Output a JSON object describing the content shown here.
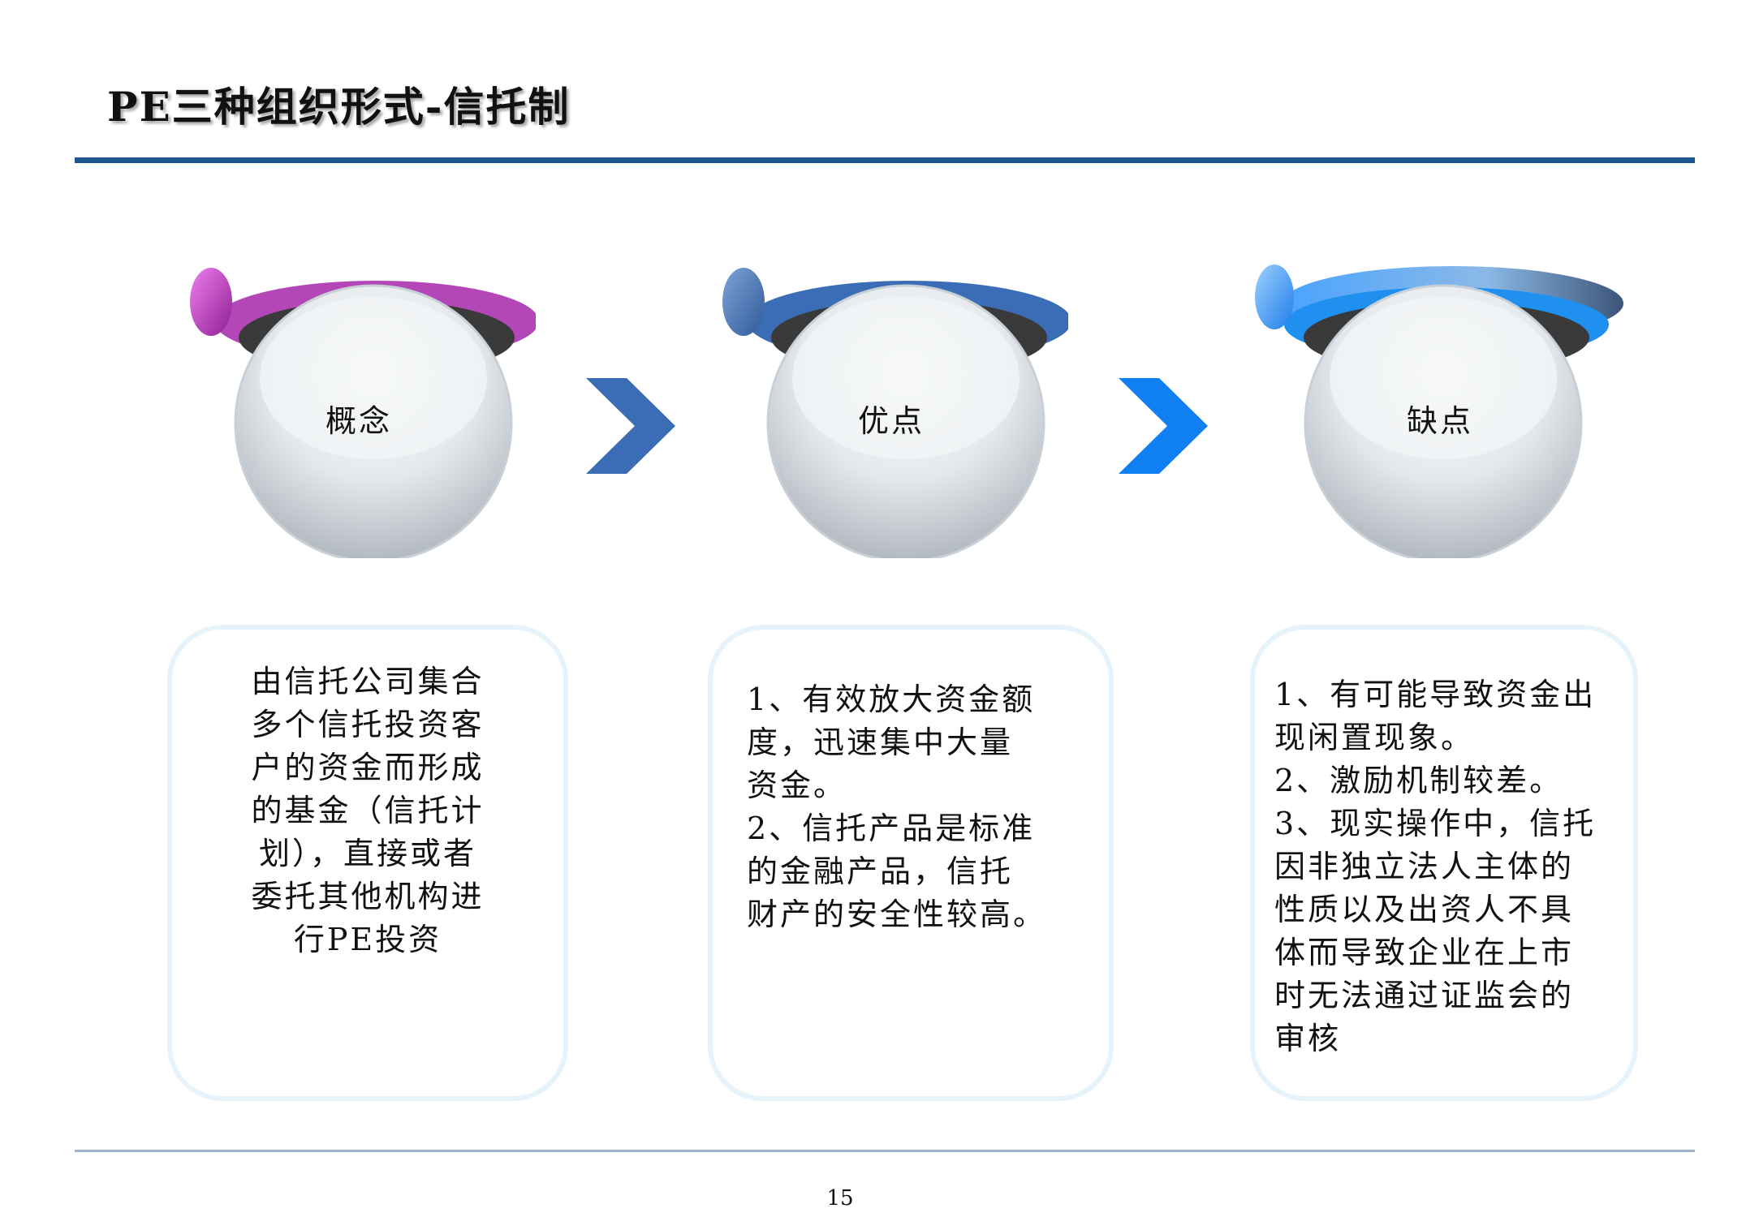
{
  "slide": {
    "title": "PE三种组织形式-信托制",
    "page_number": "15"
  },
  "steps": [
    {
      "label": "概念",
      "body": "由信托公司集合\n多个信托投资客\n户的资金而形成\n的基金（信托计\n划），直接或者\n委托其他机构进\n行PE投资",
      "accent": "#b347b8"
    },
    {
      "label": "优点",
      "body": "1、有效放大资金额\n度，迅速集中大量\n资金。\n2、信托产品是标准\n的金融产品，信托\n财产的安全性较高。",
      "accent": "#3a6db5"
    },
    {
      "label": "缺点",
      "body": "1、有可能导致资金出\n现闲置现象。\n2、激励机制较差。\n3、现实操作中，信托\n因非独立法人主体的\n性质以及出资人不具\n体而导致企业在上市\n时无法通过证监会的\n审核",
      "accent": "#3f8fd8"
    }
  ],
  "colors": {
    "rule": "#1f5592",
    "arrow_1": "#3a6db5",
    "arrow_2": "#0f7ff2",
    "card_border": "#e6f3fb"
  }
}
